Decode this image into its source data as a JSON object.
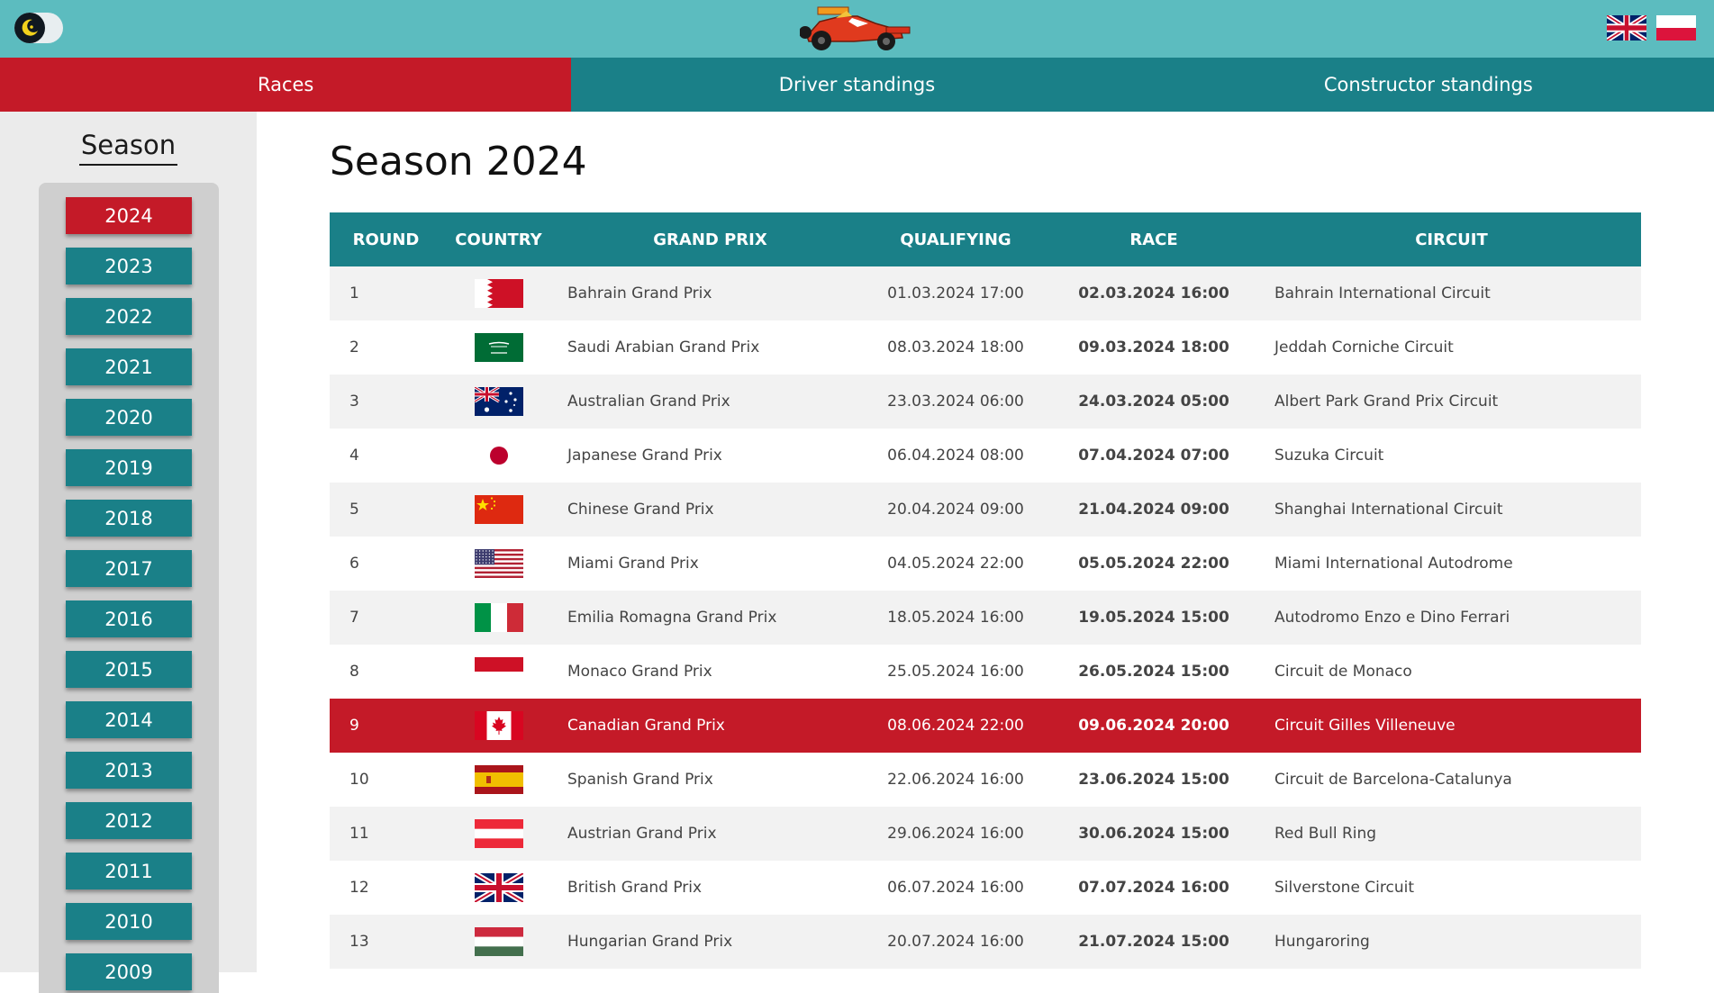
{
  "nav": {
    "tabs": [
      {
        "label": "Races",
        "active": true
      },
      {
        "label": "Driver standings",
        "active": false
      },
      {
        "label": "Constructor standings",
        "active": false
      }
    ]
  },
  "header": {
    "theme_toggle_icon": "moon-icon",
    "logo_icon": "f1-car-icon",
    "languages": [
      "english-flag-icon",
      "polish-flag-icon"
    ]
  },
  "sidebar": {
    "title": "Season",
    "years": [
      "2024",
      "2023",
      "2022",
      "2021",
      "2020",
      "2019",
      "2018",
      "2017",
      "2016",
      "2015",
      "2014",
      "2013",
      "2012",
      "2011",
      "2010",
      "2009"
    ],
    "active_year": "2024"
  },
  "main": {
    "title": "Season 2024",
    "columns": [
      "ROUND",
      "COUNTRY",
      "GRAND PRIX",
      "QUALIFYING",
      "RACE",
      "CIRCUIT"
    ],
    "current_round": "9",
    "rows": [
      {
        "round": "1",
        "flag": "bahrain-flag-icon",
        "gp": "Bahrain Grand Prix",
        "qualifying": "01.03.2024 17:00",
        "race": "02.03.2024 16:00",
        "circuit": "Bahrain International Circuit"
      },
      {
        "round": "2",
        "flag": "saudi-arabia-flag-icon",
        "gp": "Saudi Arabian Grand Prix",
        "qualifying": "08.03.2024 18:00",
        "race": "09.03.2024 18:00",
        "circuit": "Jeddah Corniche Circuit"
      },
      {
        "round": "3",
        "flag": "australia-flag-icon",
        "gp": "Australian Grand Prix",
        "qualifying": "23.03.2024 06:00",
        "race": "24.03.2024 05:00",
        "circuit": "Albert Park Grand Prix Circuit"
      },
      {
        "round": "4",
        "flag": "japan-flag-icon",
        "gp": "Japanese Grand Prix",
        "qualifying": "06.04.2024 08:00",
        "race": "07.04.2024 07:00",
        "circuit": "Suzuka Circuit"
      },
      {
        "round": "5",
        "flag": "china-flag-icon",
        "gp": "Chinese Grand Prix",
        "qualifying": "20.04.2024 09:00",
        "race": "21.04.2024 09:00",
        "circuit": "Shanghai International Circuit"
      },
      {
        "round": "6",
        "flag": "usa-flag-icon",
        "gp": "Miami Grand Prix",
        "qualifying": "04.05.2024 22:00",
        "race": "05.05.2024 22:00",
        "circuit": "Miami International Autodrome"
      },
      {
        "round": "7",
        "flag": "italy-flag-icon",
        "gp": "Emilia Romagna Grand Prix",
        "qualifying": "18.05.2024 16:00",
        "race": "19.05.2024 15:00",
        "circuit": "Autodromo Enzo e Dino Ferrari"
      },
      {
        "round": "8",
        "flag": "monaco-flag-icon",
        "gp": "Monaco Grand Prix",
        "qualifying": "25.05.2024 16:00",
        "race": "26.05.2024 15:00",
        "circuit": "Circuit de Monaco"
      },
      {
        "round": "9",
        "flag": "canada-flag-icon",
        "gp": "Canadian Grand Prix",
        "qualifying": "08.06.2024 22:00",
        "race": "09.06.2024 20:00",
        "circuit": "Circuit Gilles Villeneuve"
      },
      {
        "round": "10",
        "flag": "spain-flag-icon",
        "gp": "Spanish Grand Prix",
        "qualifying": "22.06.2024 16:00",
        "race": "23.06.2024 15:00",
        "circuit": "Circuit de Barcelona-Catalunya"
      },
      {
        "round": "11",
        "flag": "austria-flag-icon",
        "gp": "Austrian Grand Prix",
        "qualifying": "29.06.2024 16:00",
        "race": "30.06.2024 15:00",
        "circuit": "Red Bull Ring"
      },
      {
        "round": "12",
        "flag": "uk-flag-icon",
        "gp": "British Grand Prix",
        "qualifying": "06.07.2024 16:00",
        "race": "07.07.2024 16:00",
        "circuit": "Silverstone Circuit"
      },
      {
        "round": "13",
        "flag": "hungary-flag-icon",
        "gp": "Hungarian Grand Prix",
        "qualifying": "20.07.2024 16:00",
        "race": "21.07.2024 15:00",
        "circuit": "Hungaroring"
      }
    ]
  },
  "colors": {
    "header_bg": "#5cbcbf",
    "teal": "#1a8088",
    "accent_red": "#c41a28",
    "sidebar_bg": "#ebebeb",
    "year_panel_bg": "#cfcfcf"
  }
}
